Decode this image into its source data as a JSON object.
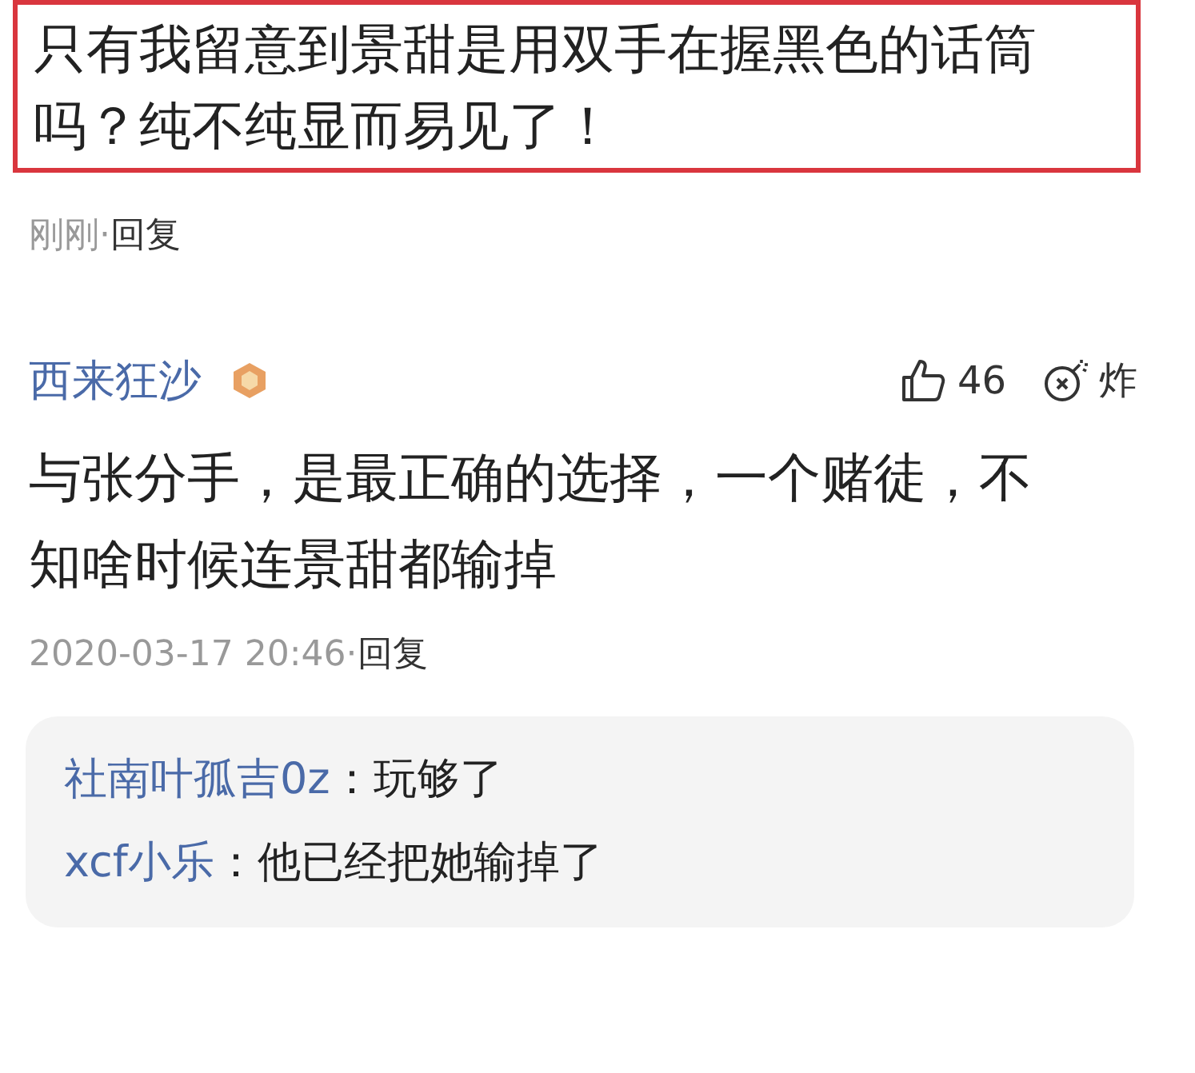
{
  "top_comment": {
    "text": "只有我留意到景甜是用双手在握黑色的话筒吗？纯不纯显而易见了！",
    "highlighted": true,
    "time": "刚刚",
    "separator": "·",
    "reply_label": "回复"
  },
  "comments": [
    {
      "author": "西来狂沙",
      "likes": "46",
      "bomb_label": "炸",
      "text": "与张分手，是最正确的选择，一个赌徒，不知啥时候连景甜都输掉",
      "time": "2020-03-17 20:46",
      "separator": "·",
      "reply_label": "回复",
      "replies": [
        {
          "author": "社南叶孤吉0z",
          "colon": "：",
          "text": "玩够了"
        },
        {
          "author": "xcf小乐",
          "colon": "：",
          "text": "他已经把她输掉了"
        }
      ]
    }
  ]
}
